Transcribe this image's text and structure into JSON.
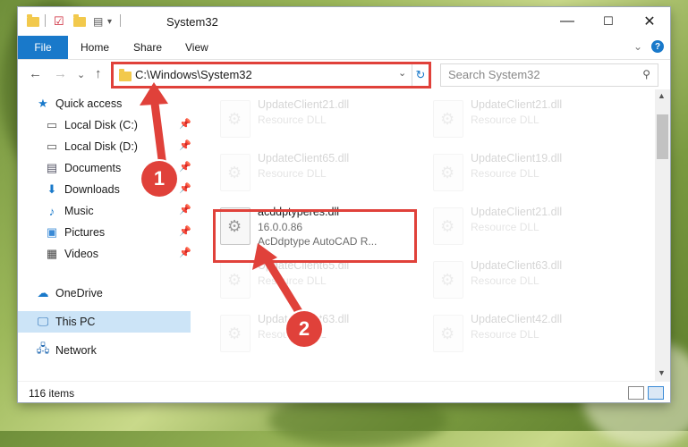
{
  "window": {
    "title": "System32",
    "controls": {
      "minimize": "—",
      "maximize": "☐",
      "close": "✕"
    }
  },
  "ribbon": {
    "file": "File",
    "tabs": [
      "Home",
      "Share",
      "View"
    ],
    "help": "?"
  },
  "address": {
    "path": "C:\\Windows\\System32",
    "refresh": "↻",
    "dropdown": "⌄"
  },
  "search": {
    "placeholder": "Search System32",
    "icon": "search-icon"
  },
  "nav": {
    "back": "←",
    "forward": "→",
    "recent": "⌄",
    "up": "↑",
    "items": [
      {
        "label": "Quick access",
        "icon": "star-icon",
        "pinned": false
      },
      {
        "label": "Local Disk (C:)",
        "icon": "drive-icon",
        "pinned": true
      },
      {
        "label": "Local Disk (D:)",
        "icon": "drive-icon",
        "pinned": true
      },
      {
        "label": "Documents",
        "icon": "documents-icon",
        "pinned": true
      },
      {
        "label": "Downloads",
        "icon": "downloads-icon",
        "pinned": true
      },
      {
        "label": "Music",
        "icon": "music-icon",
        "pinned": true
      },
      {
        "label": "Pictures",
        "icon": "pictures-icon",
        "pinned": true
      },
      {
        "label": "Videos",
        "icon": "videos-icon",
        "pinned": true
      },
      {
        "label": "OneDrive",
        "icon": "cloud-icon",
        "pinned": false
      },
      {
        "label": "This PC",
        "icon": "computer-icon",
        "pinned": false,
        "selected": true
      },
      {
        "label": "Network",
        "icon": "network-icon",
        "pinned": false
      }
    ]
  },
  "files": {
    "highlighted": {
      "name": "acddptyperes.dll",
      "version": "16.0.0.86",
      "description": "AcDdptype AutoCAD R..."
    },
    "faded": [
      {
        "name": "UpdateClient21.dll",
        "type": "Resource DLL"
      },
      {
        "name": "UpdateClient21.dll",
        "type": "Resource DLL"
      },
      {
        "name": "UpdateClient65.dll",
        "type": "Resource DLL"
      },
      {
        "name": "UpdateClient19.dll",
        "type": "Resource DLL"
      },
      {
        "name": "UpdateClient21.dll",
        "type": "Resource DLL"
      },
      {
        "name": "UpdateClient65.dll",
        "type": "Resource DLL"
      },
      {
        "name": "UpdateClient63.dll",
        "type": "Resource DLL"
      },
      {
        "name": "UpdateClient63.dll",
        "type": "Resource DLL"
      },
      {
        "name": "UpdateClient42.dll",
        "type": "Resource DLL"
      }
    ]
  },
  "status": {
    "items": "116 items"
  },
  "annotations": {
    "step1": "1",
    "step2": "2",
    "color": "#e0413a"
  }
}
